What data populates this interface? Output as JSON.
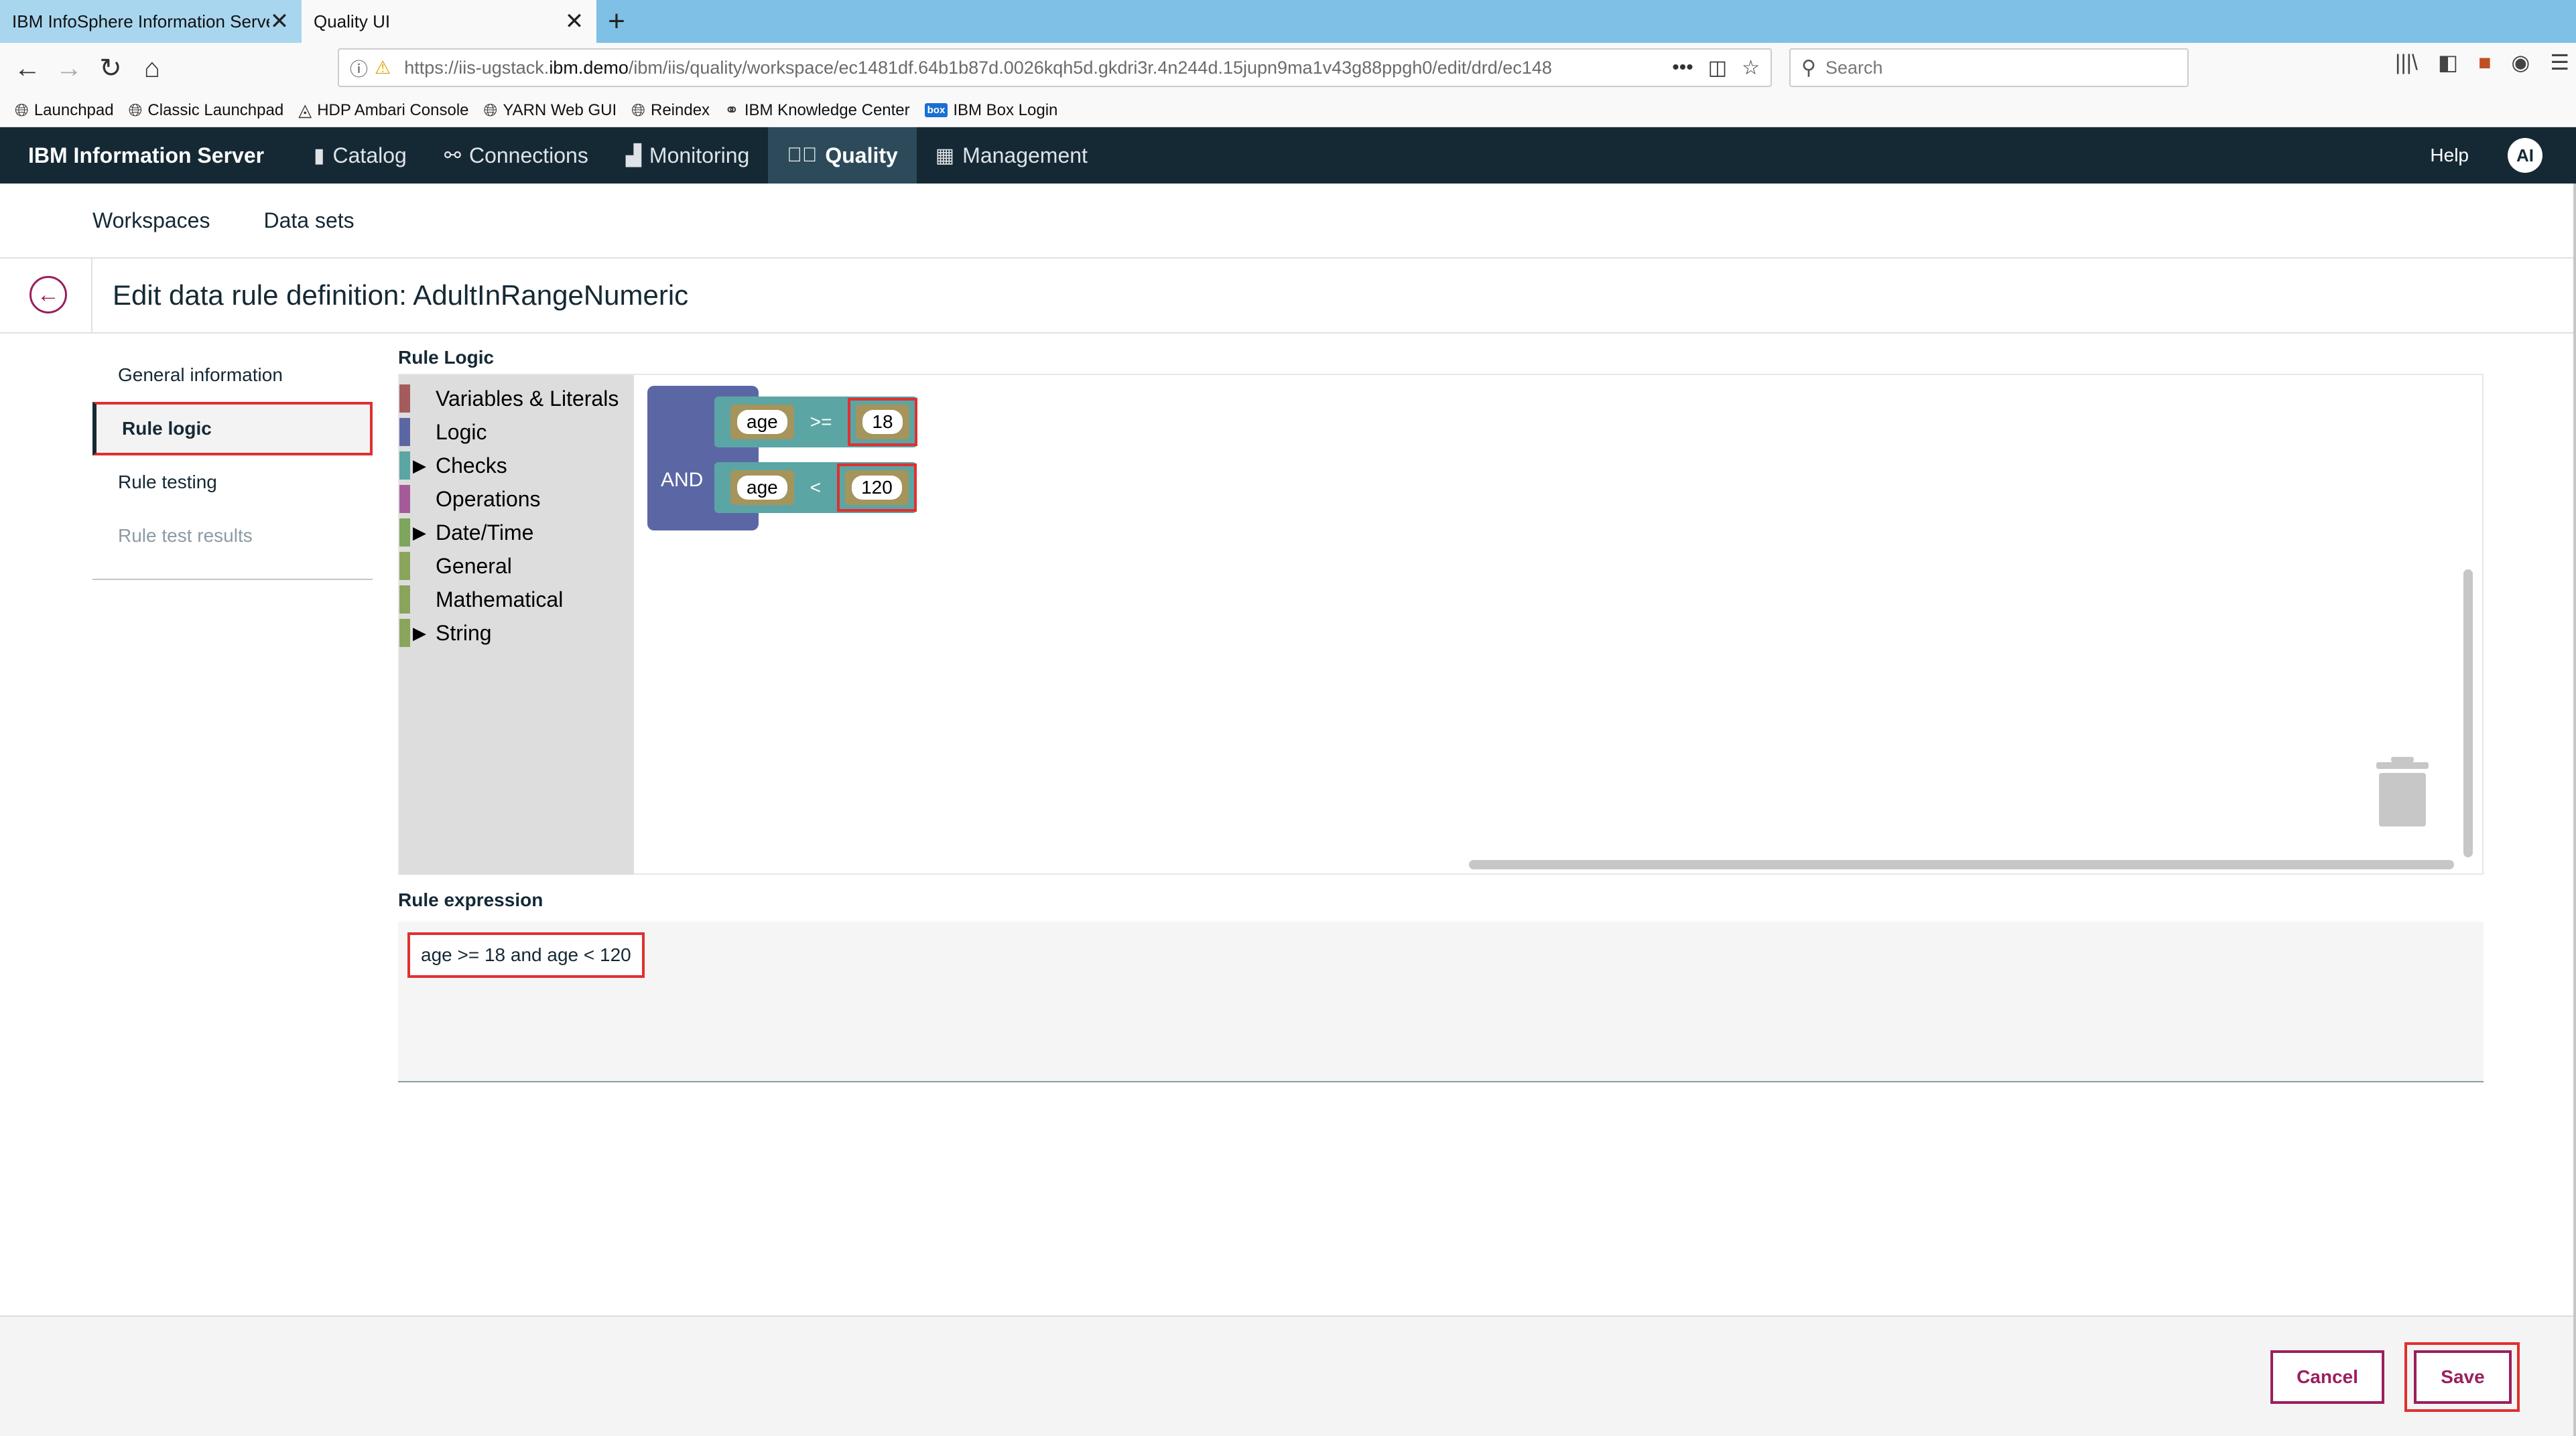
{
  "browser": {
    "tabs": [
      {
        "label": "IBM InfoSphere Information Server",
        "active": false
      },
      {
        "label": "Quality UI",
        "active": true
      }
    ],
    "url": {
      "prefix": "https://iis-ugstack.",
      "host": "ibm.demo",
      "path": "/ibm/iis/quality/workspace/ec1481df.64b1b87d.0026kqh5d.gkdri3r.4n244d.15jupn9ma1v43g88ppgh0/edit/drd/ec148"
    },
    "search_placeholder": "Search",
    "bookmarks": [
      {
        "label": "Launchpad",
        "icon": "globe-icon"
      },
      {
        "label": "Classic Launchpad",
        "icon": "globe-icon"
      },
      {
        "label": "HDP Ambari Console",
        "icon": "ambari-icon"
      },
      {
        "label": "YARN Web GUI",
        "icon": "globe-icon"
      },
      {
        "label": "Reindex",
        "icon": "globe-icon"
      },
      {
        "label": "IBM Knowledge Center",
        "icon": "knowledge-icon"
      },
      {
        "label": "IBM Box Login",
        "icon": "box-icon"
      }
    ]
  },
  "app": {
    "brand": "IBM Information Server",
    "nav": [
      {
        "label": "Catalog",
        "icon": "book-icon"
      },
      {
        "label": "Connections",
        "icon": "connections-icon"
      },
      {
        "label": "Monitoring",
        "icon": "bar-chart-icon"
      },
      {
        "label": "Quality",
        "icon": "check-circle-icon",
        "active": true
      },
      {
        "label": "Management",
        "icon": "calendar-icon"
      }
    ],
    "help": "Help",
    "avatar_initials": "AI"
  },
  "subnav": [
    "Workspaces",
    "Data sets"
  ],
  "page": {
    "title": "Edit data rule definition: AdultInRangeNumeric"
  },
  "leftnav": [
    {
      "label": "General information"
    },
    {
      "label": "Rule logic",
      "active": true
    },
    {
      "label": "Rule testing"
    },
    {
      "label": "Rule test results",
      "dim": true
    }
  ],
  "rule_logic": {
    "label": "Rule Logic",
    "categories": [
      {
        "label": "Variables & Literals",
        "color": "#a55b5b",
        "expandable": false
      },
      {
        "label": "Logic",
        "color": "#5b67a5",
        "expandable": false
      },
      {
        "label": "Checks",
        "color": "#5ba5a5",
        "expandable": true
      },
      {
        "label": "Operations",
        "color": "#a55b99",
        "expandable": false
      },
      {
        "label": "Date/Time",
        "color": "#7da55b",
        "expandable": true
      },
      {
        "label": "General",
        "color": "#8aa55b",
        "expandable": false
      },
      {
        "label": "Mathematical",
        "color": "#8aa55b",
        "expandable": false
      },
      {
        "label": "String",
        "color": "#8aa55b",
        "expandable": true
      }
    ],
    "block": {
      "operator": "AND",
      "conditions": [
        {
          "field": "age",
          "op": ">=",
          "value": "18"
        },
        {
          "field": "age",
          "op": "<",
          "value": "120"
        }
      ]
    }
  },
  "rule_expression": {
    "label": "Rule expression",
    "value": "age >= 18 and age < 120"
  },
  "footer": {
    "cancel": "Cancel",
    "save": "Save"
  }
}
